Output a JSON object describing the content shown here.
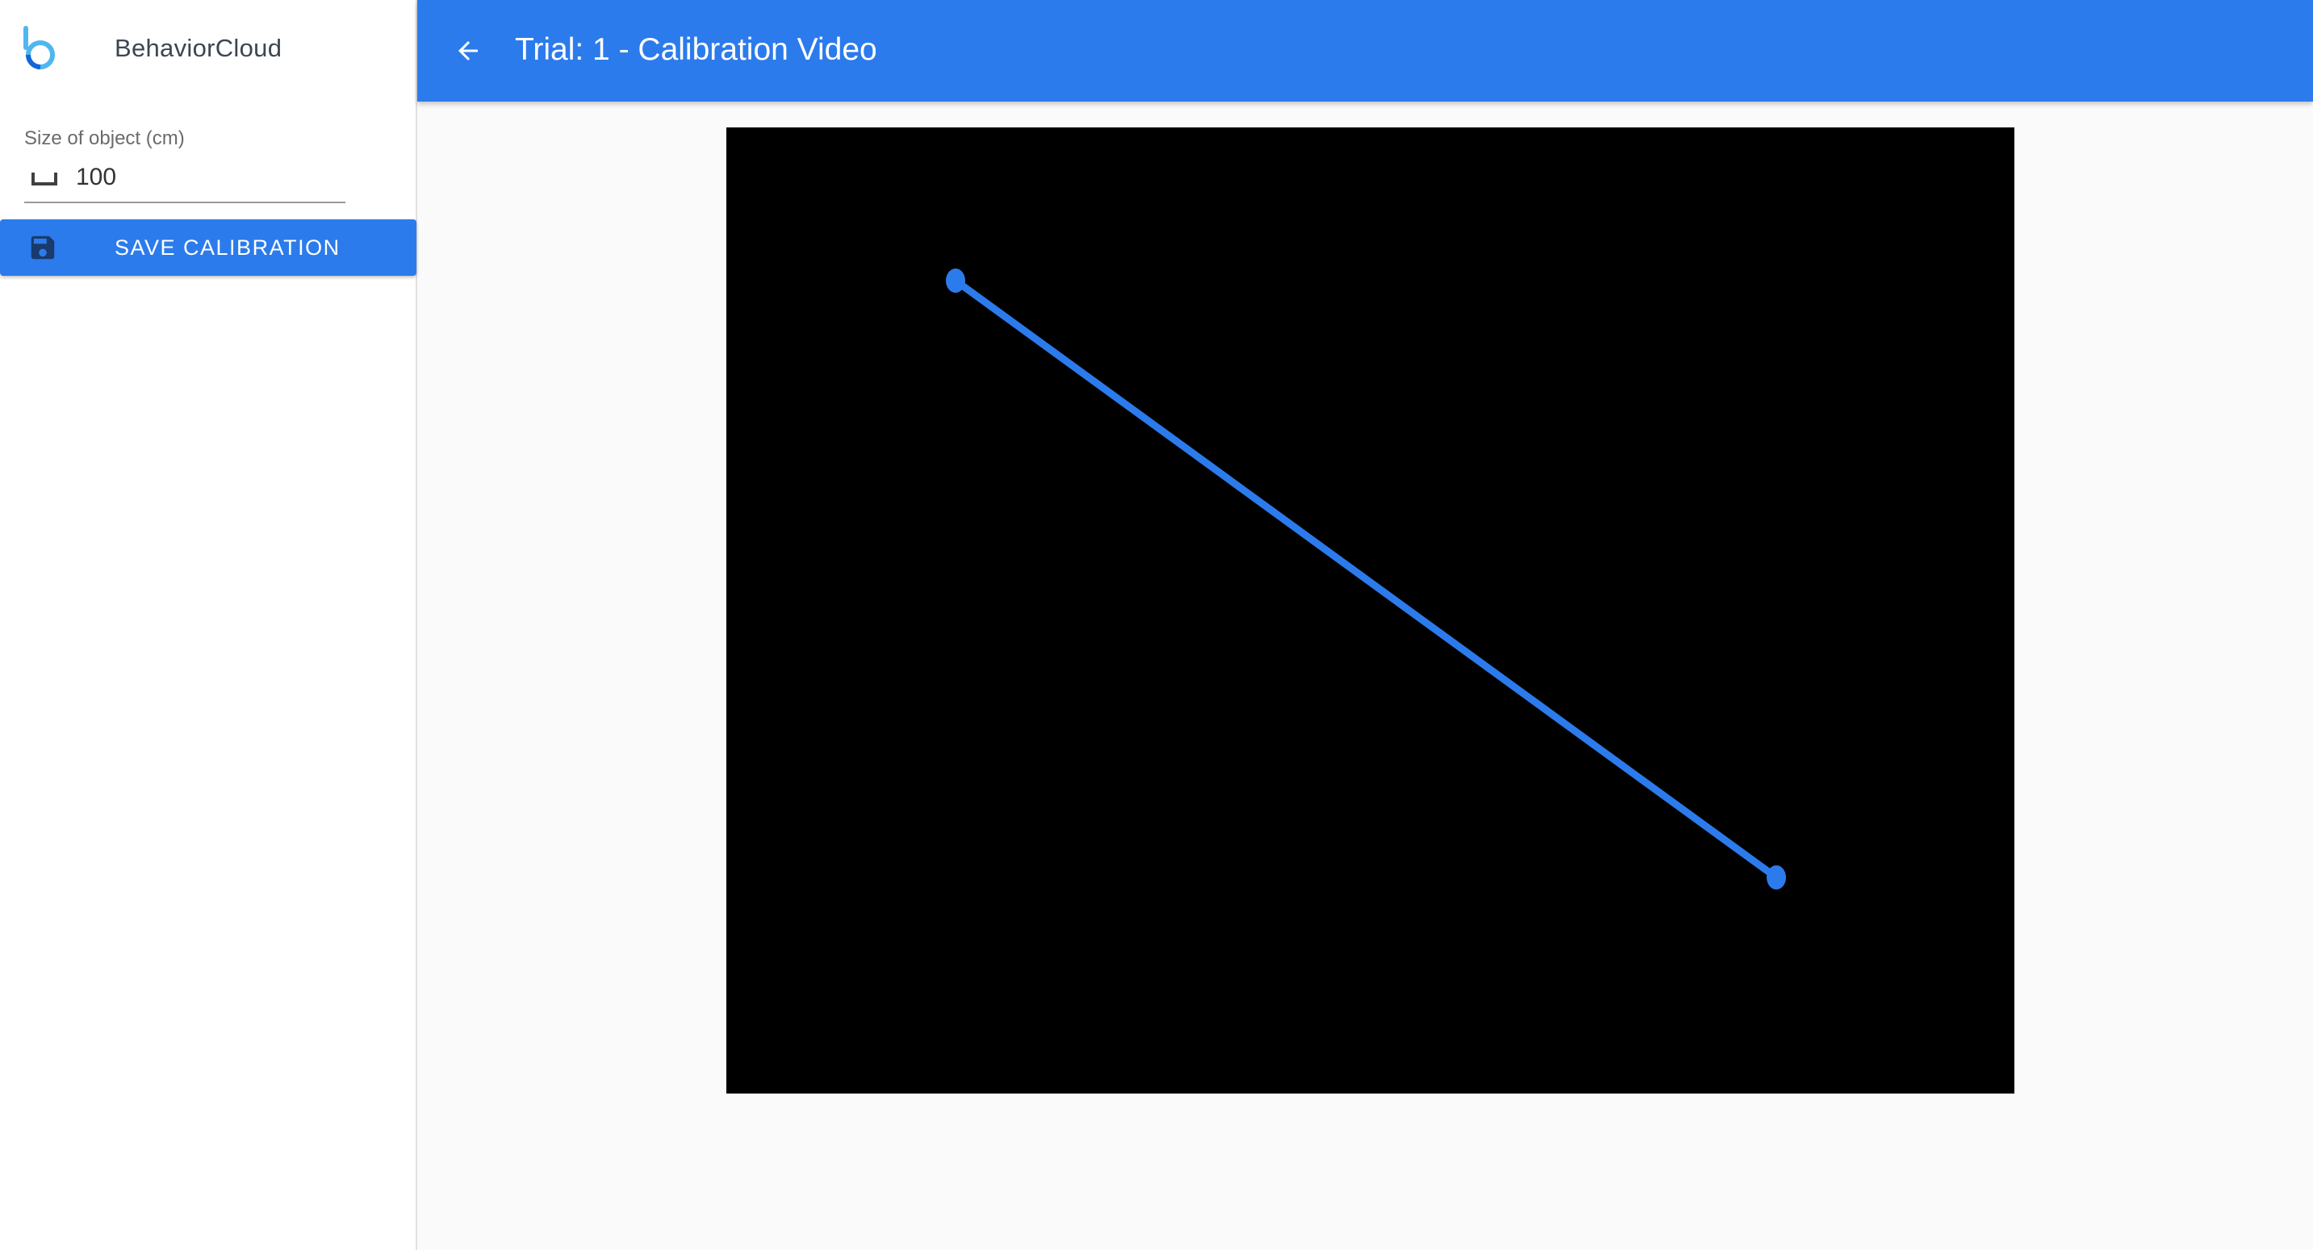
{
  "app": {
    "brand_name": "BehaviorCloud",
    "logo_icon": "behaviorcloud-logo-icon"
  },
  "sidebar": {
    "size_field": {
      "label": "Size of object (cm)",
      "value": "100",
      "icon": "ruler-icon"
    },
    "save_button": {
      "label": "SAVE CALIBRATION",
      "icon": "save-icon"
    }
  },
  "header": {
    "back_icon": "arrow-back-icon",
    "title": "Trial: 1 - Calibration Video"
  },
  "colors": {
    "primary": "#2c7bec",
    "video_background": "#000000",
    "calibration_line": "#2c7bec"
  }
}
